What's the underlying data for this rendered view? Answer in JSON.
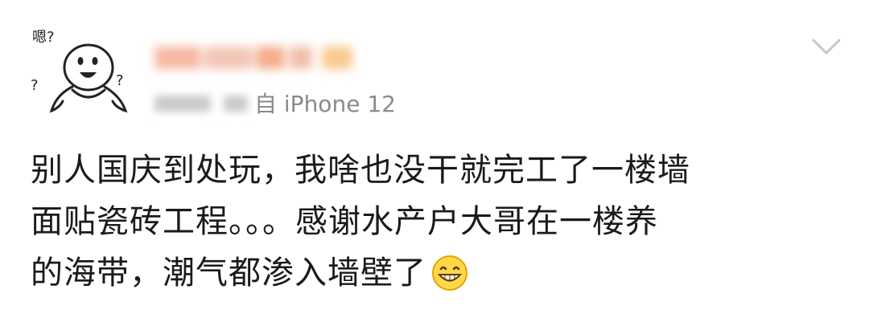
{
  "post": {
    "source_text": "自 iPhone 12",
    "content_lines": [
      "别人国庆到处玩，我啥也没干就完工了一楼墙",
      "面贴瓷砖工程。。。感谢水产户大哥在一楼养",
      "的海带，潮气都渗入墙壁了"
    ],
    "emoji": "grinning-face",
    "avatar_text": {
      "top": "嗯?",
      "q1": "?",
      "q2": "?"
    }
  },
  "colors": {
    "text": "#1a1a1a",
    "meta_text": "#8a8a8a",
    "chevron": "#c7c7c7",
    "name_blur": [
      "#f6b8a3",
      "#f2c5b5",
      "#f4ad8c",
      "#f9c98e"
    ]
  }
}
